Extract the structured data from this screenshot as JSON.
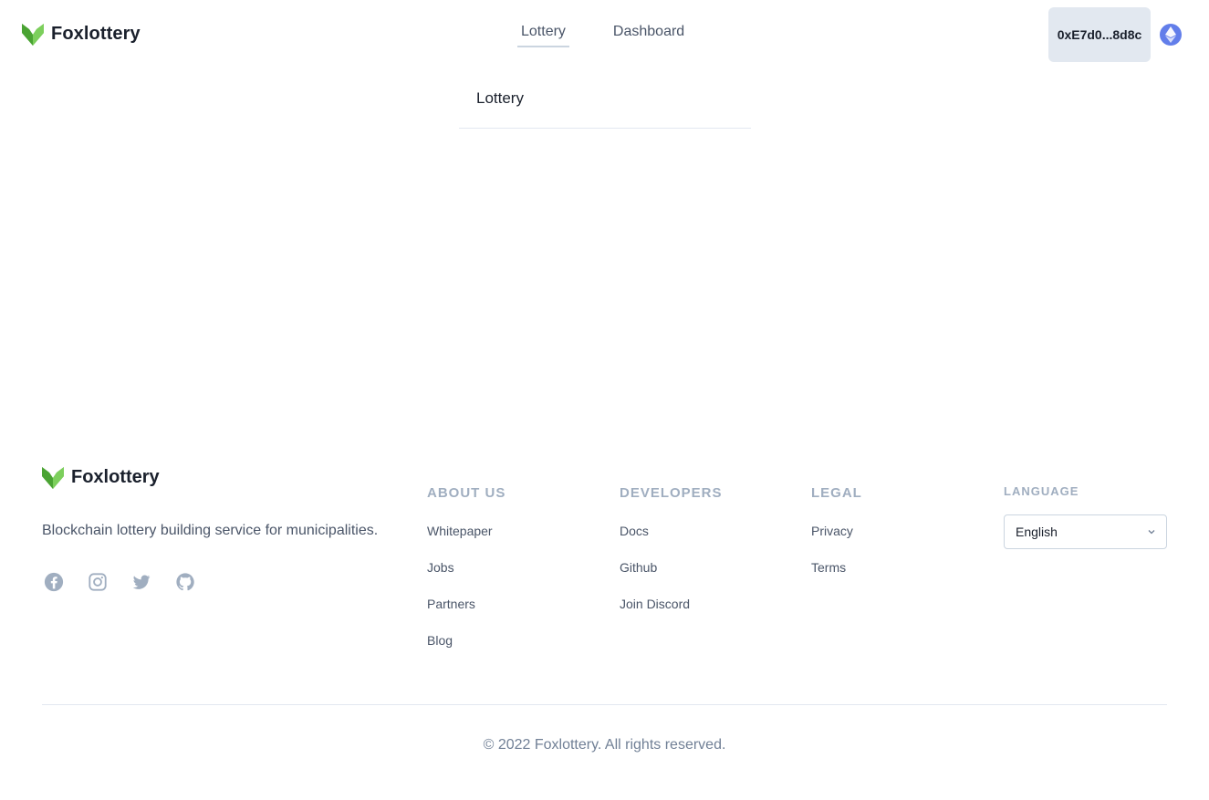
{
  "header": {
    "brand": "Foxlottery",
    "nav": [
      {
        "label": "Lottery",
        "active": true
      },
      {
        "label": "Dashboard",
        "active": false
      }
    ],
    "wallet_address": "0xE7d0...8d8c",
    "network_icon": "ethereum-icon"
  },
  "main": {
    "tabs": [
      {
        "label": "Lottery"
      }
    ]
  },
  "footer": {
    "brand": "Foxlottery",
    "tagline": "Blockchain lottery building service for municipalities.",
    "socials": [
      "facebook-icon",
      "instagram-icon",
      "twitter-icon",
      "github-icon"
    ],
    "columns": [
      {
        "title": "About Us",
        "links": [
          "Whitepaper",
          "Jobs",
          "Partners",
          "Blog"
        ]
      },
      {
        "title": "Developers",
        "links": [
          "Docs",
          "Github",
          "Join Discord"
        ]
      },
      {
        "title": "Legal",
        "links": [
          "Privacy",
          "Terms"
        ]
      }
    ],
    "language": {
      "title": "Language",
      "selected": "English"
    },
    "copyright": "© 2022 Foxlottery. All rights reserved."
  },
  "colors": {
    "logo_green": "#6abf4b",
    "logo_dark_green": "#3f8f2b",
    "ethereum": "#627eea",
    "wallet_bg": "#e2e8f0"
  }
}
